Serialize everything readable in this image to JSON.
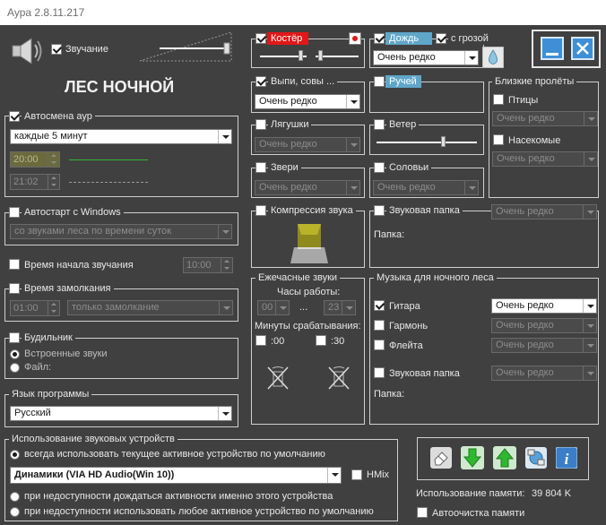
{
  "window": {
    "title": "Аура 2.8.11.217"
  },
  "sound": {
    "enabled_label": "Звучание",
    "enabled": true,
    "scene_name": "ЛЕС НОЧНОЙ"
  },
  "auto_change": {
    "label": "Автосмена аур",
    "checked": true,
    "interval": "каждые 5 минут",
    "time1": "20:00",
    "time2": "21:02"
  },
  "autostart": {
    "label": "Автостарт с Windows",
    "checked": false,
    "mode": "со звуками леса по времени суток"
  },
  "start_time": {
    "label": "Время начала звучания",
    "checked": false,
    "value": "10:00"
  },
  "fade_time": {
    "label": "Время замолкания",
    "checked": false,
    "value": "01:00",
    "mode": "только замолкание"
  },
  "alarm": {
    "label": "Будильник",
    "checked": false,
    "options": [
      "Встроенные звуки",
      "Файл:"
    ],
    "selected": 0
  },
  "language": {
    "label": "Язык программы",
    "value": "Русский"
  },
  "devices": {
    "label": "Использование звуковых устройств",
    "option_default": "всегда использовать текущее активное устройство по умолчанию",
    "device": "Динамики (VIA HD Audio(Win 10))",
    "hmix": "HMix",
    "option_wait": "при недоступности дождаться активности именно этого устройства",
    "option_any": "при недоступности использовать любое активное устройство по умолчанию",
    "selected": 0
  },
  "sounds": {
    "campfire": {
      "label": "Костёр",
      "checked": true,
      "color": "#e01818"
    },
    "rain": {
      "label": "Дождь",
      "checked": true,
      "freq": "Очень редко",
      "color": "#5fa6c9"
    },
    "thunder": {
      "label": "с грозой",
      "checked": true
    },
    "howls": {
      "label": "Выпи, совы ...",
      "checked": true,
      "freq": "Очень редко"
    },
    "stream": {
      "label": "Ручей",
      "checked": false,
      "color": "#5fa6c9"
    },
    "frogs": {
      "label": "Лягушки",
      "checked": false,
      "freq": "Очень редко"
    },
    "wind": {
      "label": "Ветер",
      "checked": false
    },
    "beasts": {
      "label": "Звери",
      "checked": false,
      "freq": "Очень редко"
    },
    "nightingales": {
      "label": "Соловьи",
      "checked": false,
      "freq": "Очень редко"
    },
    "compression": {
      "label": "Компрессия звука",
      "checked": false
    },
    "folder": {
      "label": "Звуковая папка",
      "checked": false,
      "freq": "Очень редко",
      "path_label": "Папка:"
    }
  },
  "flyby": {
    "label": "Близкие пролёты",
    "birds": {
      "label": "Птицы",
      "checked": false,
      "freq": "Очень редко"
    },
    "insects": {
      "label": "Насекомые",
      "checked": false,
      "freq": "Очень редко"
    }
  },
  "hourly": {
    "label": "Ежечасные звуки",
    "hours_label": "Часы работы:",
    "from": "00",
    "dots": "...",
    "to": "23",
    "minutes_label": "Минуты срабатывания:",
    "m00": {
      "label": ":00",
      "checked": false
    },
    "m30": {
      "label": ":30",
      "checked": false
    }
  },
  "music": {
    "label": "Музыка для ночного леса",
    "items": [
      {
        "label": "Гитара",
        "checked": true,
        "freq": "Очень редко"
      },
      {
        "label": "Гармонь",
        "checked": false,
        "freq": "Очень редко"
      },
      {
        "label": "Флейта",
        "checked": false,
        "freq": "Очень редко"
      }
    ],
    "folder": {
      "label": "Звуковая папка",
      "checked": false,
      "freq": "Очень редко"
    },
    "path_label": "Папка:"
  },
  "memory": {
    "label": "Использование памяти:",
    "value": "39 804 K",
    "autoclean_label": "Автоочистка памяти",
    "autoclean": false
  }
}
